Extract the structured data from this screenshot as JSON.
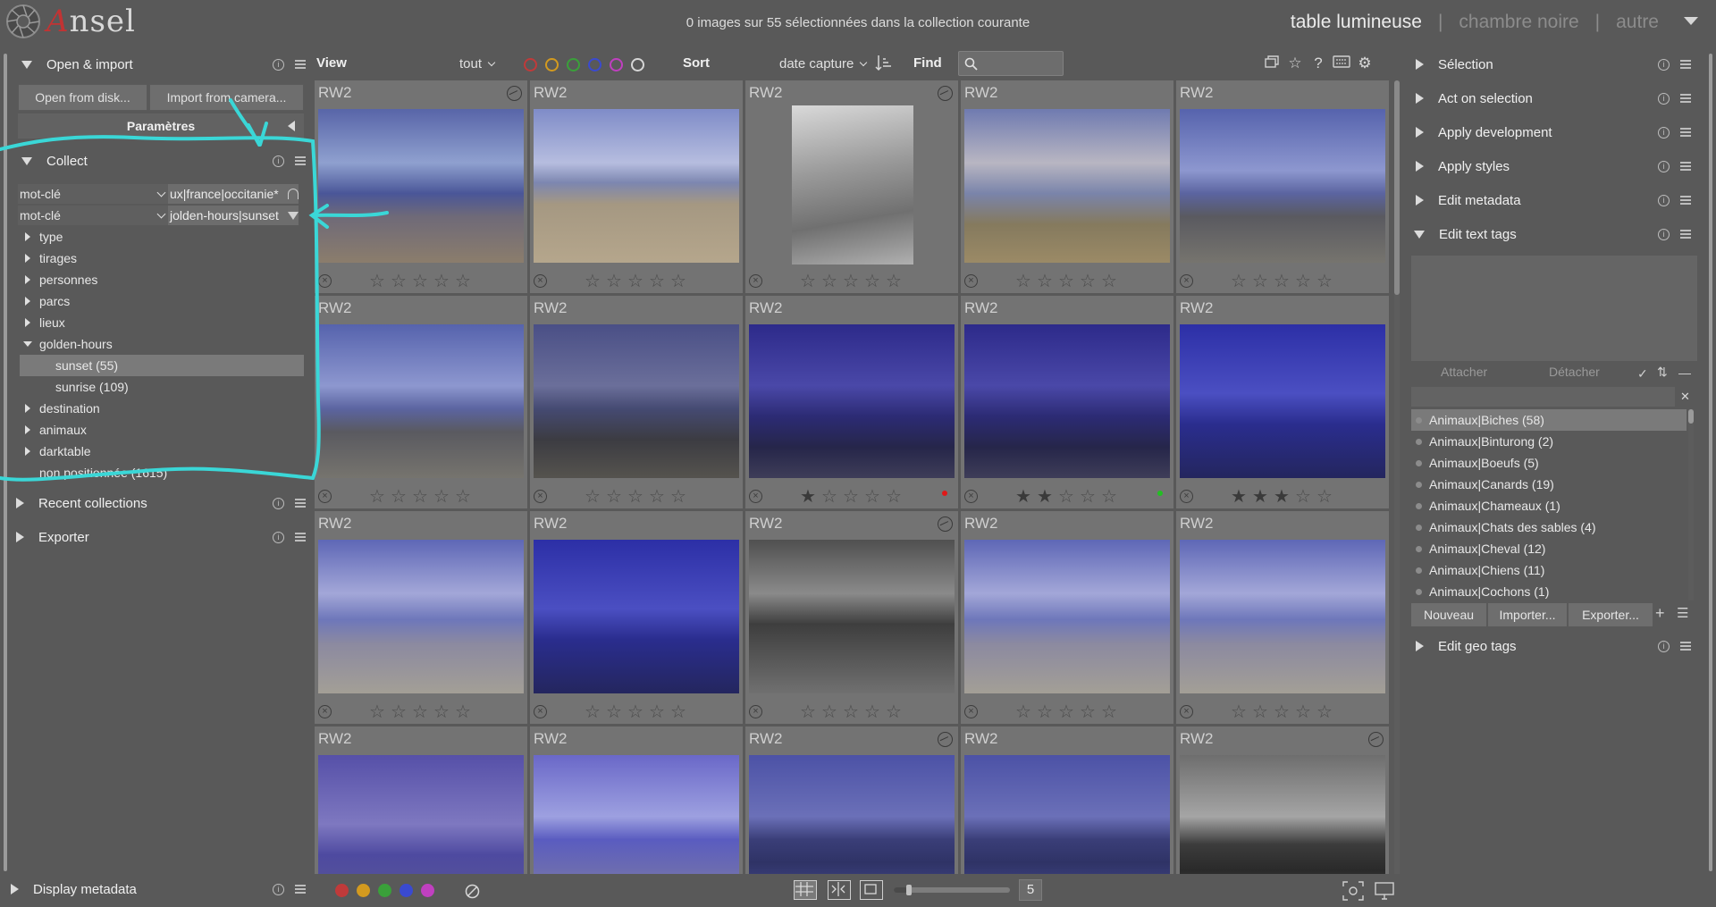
{
  "app": {
    "name_initial": "A",
    "name_rest": "nsel"
  },
  "header": {
    "status": "0 images sur 55 sélectionnées dans la collection courante",
    "views": [
      "table lumineuse",
      "chambre noire",
      "autre"
    ],
    "active_view": "table lumineuse"
  },
  "left_panel": {
    "open_import": {
      "title": "Open & import",
      "open_disk": "Open from disk...",
      "import_camera": "Import from camera...",
      "params": "Paramètres"
    },
    "collect": {
      "title": "Collect",
      "rules": [
        {
          "property": "mot-clé",
          "value": "ux|france|occitanie*"
        },
        {
          "property": "mot-clé",
          "value": "jolden-hours|sunset"
        }
      ],
      "tree": [
        {
          "label": "type",
          "level": 0,
          "expanded": false,
          "selected": false
        },
        {
          "label": "tirages",
          "level": 0,
          "expanded": false,
          "selected": false
        },
        {
          "label": "personnes",
          "level": 0,
          "expanded": false,
          "selected": false
        },
        {
          "label": "parcs",
          "level": 0,
          "expanded": false,
          "selected": false
        },
        {
          "label": "lieux",
          "level": 0,
          "expanded": false,
          "selected": false
        },
        {
          "label": "golden-hours",
          "level": 0,
          "expanded": true,
          "selected": false
        },
        {
          "label": "sunset (55)",
          "level": 1,
          "expanded": null,
          "selected": true
        },
        {
          "label": "sunrise (109)",
          "level": 1,
          "expanded": null,
          "selected": false
        },
        {
          "label": "destination",
          "level": 0,
          "expanded": false,
          "selected": false
        },
        {
          "label": "animaux",
          "level": 0,
          "expanded": false,
          "selected": false
        },
        {
          "label": "darktable",
          "level": 0,
          "expanded": false,
          "selected": false
        },
        {
          "label": "non positionnée (1615)",
          "level": 0,
          "expanded": null,
          "selected": false
        }
      ]
    },
    "recent": {
      "title": "Recent collections"
    },
    "export": {
      "title": "Exporter"
    },
    "display_metadata": {
      "title": "Display metadata"
    }
  },
  "toolbar": {
    "view_label": "View",
    "filter_value": "tout",
    "sort_label": "Sort",
    "sort_value": "date capture",
    "find_label": "Find",
    "color_filters": [
      "#c03a3a",
      "#d39a1f",
      "#3aa03a",
      "#3a4ad0",
      "#c040c0",
      "#d6d6d6"
    ]
  },
  "thumbnails": [
    {
      "format": "RW2",
      "stars": 0,
      "altered": true,
      "label": "",
      "scene": "cloud-blue"
    },
    {
      "format": "RW2",
      "stars": 0,
      "altered": false,
      "label": "",
      "scene": "beach-warm"
    },
    {
      "format": "RW2",
      "stars": 0,
      "altered": true,
      "label": "",
      "scene": "bw-portrait"
    },
    {
      "format": "RW2",
      "stars": 0,
      "altered": false,
      "label": "",
      "scene": "cloud-dusk"
    },
    {
      "format": "RW2",
      "stars": 0,
      "altered": false,
      "label": "",
      "scene": "blue-rocks"
    },
    {
      "format": "RW2",
      "stars": 0,
      "altered": false,
      "label": "",
      "scene": "blue-rocks"
    },
    {
      "format": "RW2",
      "stars": 0,
      "altered": false,
      "label": "",
      "scene": "dark-rocks"
    },
    {
      "format": "RW2",
      "stars": 1,
      "altered": false,
      "label": "#e01818",
      "scene": "night-blue"
    },
    {
      "format": "RW2",
      "stars": 2,
      "altered": false,
      "label": "#22c022",
      "scene": "night-blue"
    },
    {
      "format": "RW2",
      "stars": 3,
      "altered": false,
      "label": "",
      "scene": "deep-blue"
    },
    {
      "format": "RW2",
      "stars": 0,
      "altered": false,
      "label": "",
      "scene": "waves"
    },
    {
      "format": "RW2",
      "stars": 0,
      "altered": false,
      "label": "",
      "scene": "deep-blue"
    },
    {
      "format": "RW2",
      "stars": 0,
      "altered": true,
      "label": "",
      "scene": "bw-shore"
    },
    {
      "format": "RW2",
      "stars": 0,
      "altered": false,
      "label": "",
      "scene": "waves"
    },
    {
      "format": "RW2",
      "stars": 0,
      "altered": false,
      "label": "",
      "scene": "waves"
    },
    {
      "format": "RW2",
      "stars": 0,
      "altered": false,
      "label": "",
      "scene": "violet-sky"
    },
    {
      "format": "RW2",
      "stars": 0,
      "altered": false,
      "label": "",
      "scene": "violet-sea"
    },
    {
      "format": "RW2",
      "stars": 0,
      "altered": true,
      "label": "",
      "scene": "city-night"
    },
    {
      "format": "RW2",
      "stars": 0,
      "altered": false,
      "label": "",
      "scene": "city-night"
    },
    {
      "format": "RW2",
      "stars": 0,
      "altered": true,
      "label": "",
      "scene": "bw-city"
    }
  ],
  "bottom_bar": {
    "color_labels": [
      "#c03a3a",
      "#d39a1f",
      "#3aa03a",
      "#3a4ad0",
      "#c040c0"
    ],
    "zoom_value": "5"
  },
  "right_panel": {
    "modules": [
      "Sélection",
      "Act on selection",
      "Apply development",
      "Apply styles",
      "Edit metadata",
      "Edit text tags"
    ],
    "tags": {
      "attach": "Attacher",
      "detach": "Détacher",
      "items": [
        "Animaux|Biches (58)",
        "Animaux|Binturong (2)",
        "Animaux|Boeufs (5)",
        "Animaux|Canards (19)",
        "Animaux|Chameaux (1)",
        "Animaux|Chats des sables (4)",
        "Animaux|Cheval (12)",
        "Animaux|Chiens (11)",
        "Animaux|Cochons (1)"
      ],
      "new": "Nouveau",
      "import": "Importer...",
      "export": "Exporter..."
    },
    "geo_title": "Edit geo tags"
  },
  "colors": {
    "background": "#595959",
    "annotation": "#3ad7d7"
  }
}
